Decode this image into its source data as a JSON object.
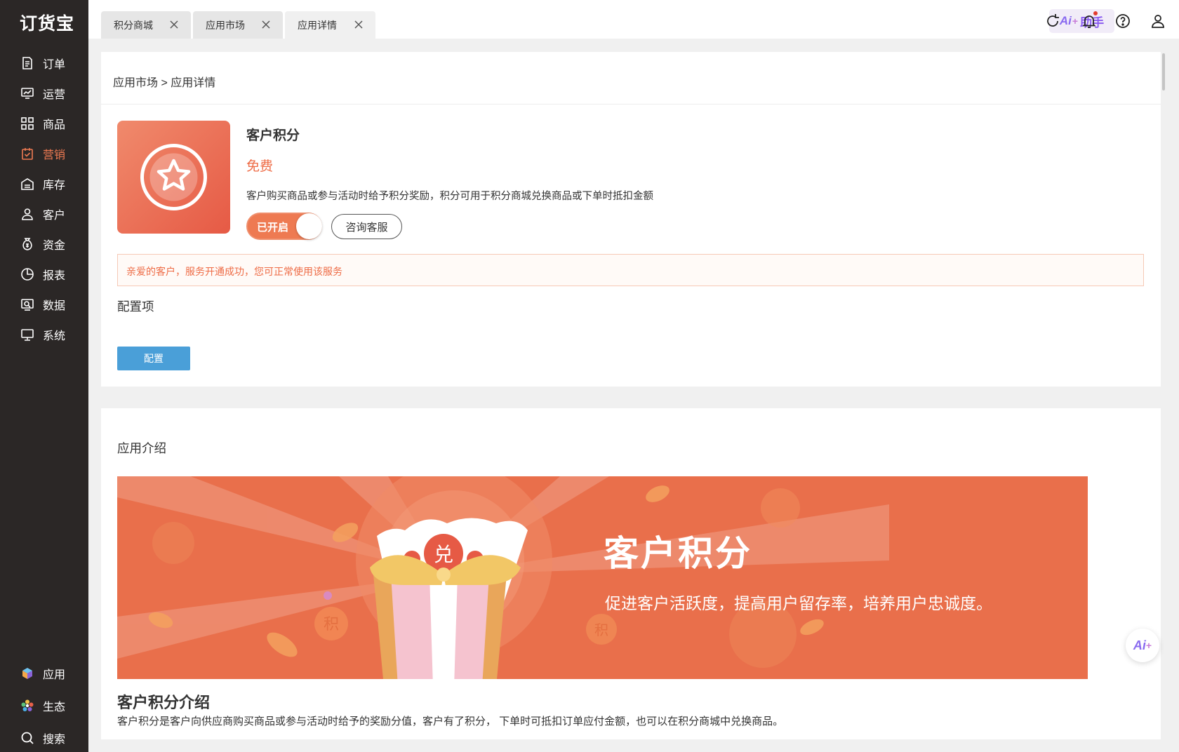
{
  "brand": {
    "logo_text": "订货宝"
  },
  "sidebar": {
    "items": [
      {
        "label": "订单",
        "icon": "order-icon"
      },
      {
        "label": "运营",
        "icon": "operation-icon"
      },
      {
        "label": "商品",
        "icon": "product-icon"
      },
      {
        "label": "营销",
        "icon": "marketing-icon",
        "active": true
      },
      {
        "label": "库存",
        "icon": "inventory-icon"
      },
      {
        "label": "客户",
        "icon": "customer-icon"
      },
      {
        "label": "资金",
        "icon": "funds-icon"
      },
      {
        "label": "报表",
        "icon": "report-icon"
      },
      {
        "label": "数据",
        "icon": "data-icon"
      },
      {
        "label": "系统",
        "icon": "system-icon"
      }
    ],
    "bottom_items": [
      {
        "label": "应用",
        "icon": "apps-cube-icon"
      },
      {
        "label": "生态",
        "icon": "ecosystem-flower-icon"
      },
      {
        "label": "搜索",
        "icon": "search-icon"
      }
    ]
  },
  "tabs": [
    {
      "label": "积分商城"
    },
    {
      "label": "应用市场"
    },
    {
      "label": "应用详情",
      "active": true
    }
  ],
  "header": {
    "ai_label": "Ai",
    "ai_plus": "+",
    "ai_assistant_label": "助手",
    "icons": [
      "refresh-icon",
      "bell-icon",
      "help-icon",
      "user-icon"
    ]
  },
  "breadcrumb": {
    "parent": "应用市场",
    "separator": ">",
    "current": "应用详情"
  },
  "app": {
    "name": "客户积分",
    "price": "免费",
    "description": "客户购买商品或参与活动时给予积分奖励，积分可用于积分商城兑换商品或下单时抵扣金额",
    "toggle_label": "已开启",
    "toggle_on": true,
    "consult_label": "咨询客服"
  },
  "alert": {
    "message": "亲爱的客户，服务开通成功，您可正常使用该服务"
  },
  "config": {
    "section_title": "配置项",
    "button_label": "配置"
  },
  "intro": {
    "section_title": "应用介绍",
    "banner_title": "客户积分",
    "banner_subtitle": "促进客户活跃度，提高用户留存率，培养用户忠诚度。",
    "banner_coupon_char": "兑",
    "banner_coin_char": "积",
    "heading": "客户积分介绍",
    "text": "客户积分是客户向供应商购买商品或参与活动时给予的奖励分值，客户有了积分，  下单时可抵扣订单应付金额，也可以在积分商城中兑换商品。"
  },
  "float_ai": {
    "label": "Ai",
    "plus": "+"
  },
  "colors": {
    "sidebar_bg": "#2b2726",
    "accent": "#ee7a52",
    "config_button": "#4a9fd8",
    "banner_bg": "#e96f4b"
  }
}
